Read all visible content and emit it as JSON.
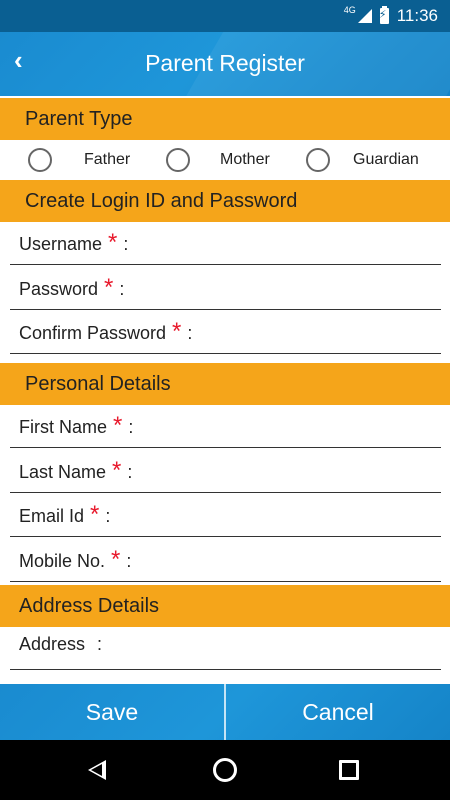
{
  "status_bar": {
    "network": "4G",
    "time": "11:36"
  },
  "header": {
    "title": "Parent Register",
    "back_icon": "‹"
  },
  "sections": {
    "parent_type": "Parent Type",
    "login": "Create Login ID and Password",
    "personal": "Personal Details",
    "address": "Address Details"
  },
  "parent_type_options": [
    "Father",
    "Mother",
    "Guardian"
  ],
  "fields": {
    "username": "Username",
    "password": "Password",
    "confirm_password": "Confirm Password",
    "first_name": "First Name",
    "last_name": "Last Name",
    "email": "Email Id",
    "mobile": "Mobile No.",
    "address": "Address"
  },
  "required_mark": "*",
  "colon": ":",
  "buttons": {
    "save": "Save",
    "cancel": "Cancel"
  },
  "colors": {
    "accent": "#1e96d9",
    "section": "#f5a51a",
    "required": "#e8192c"
  }
}
